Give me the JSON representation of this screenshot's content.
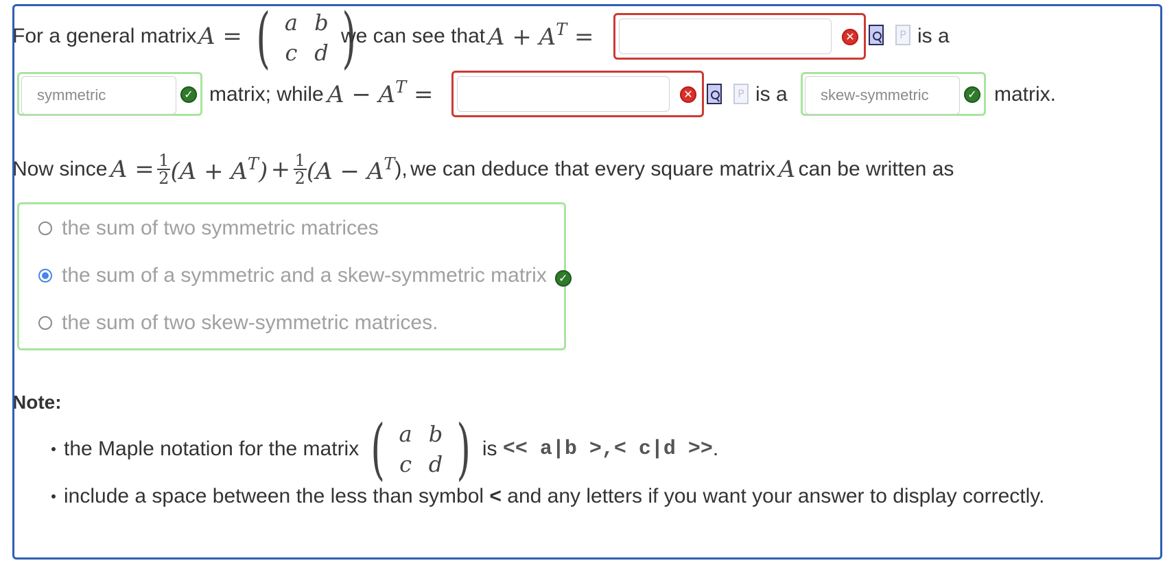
{
  "line1": {
    "prefix": "For a general matrix",
    "math_A_eq": "A =",
    "matrix": [
      "a",
      "b",
      "c",
      "d"
    ],
    "mid": "we can see that",
    "math_sum_base": "A + A",
    "math_sup": "T",
    "math_eq": "=",
    "answer_value": "",
    "suffix": "is a"
  },
  "line2": {
    "type1_value": "symmetric",
    "middle": "matrix; while",
    "math_diff_base": "A − A",
    "math_sup": "T",
    "math_eq": "=",
    "answer_value": "",
    "is_a": "is a",
    "type2_value": "skew-symmetric",
    "suffix": "matrix."
  },
  "line3": {
    "prefix": "Now since",
    "math_start": "A =",
    "half_num": "1",
    "half_den": "2",
    "term1_base": "(A + A",
    "term1_close": ")",
    "plus": "+",
    "term2_base": "(A − A",
    "term2_close": "),",
    "sup": "T",
    "middle": "we can deduce that every square matrix",
    "math_A": "A",
    "suffix": "can be written as"
  },
  "options": [
    {
      "label": "the sum of two symmetric matrices",
      "selected": false
    },
    {
      "label": "the sum of a symmetric and a skew-symmetric matrix",
      "selected": true
    },
    {
      "label": "the sum of two skew-symmetric matrices.",
      "selected": false
    }
  ],
  "note": {
    "title": "Note:",
    "b1_prefix": "the Maple notation for the matrix",
    "b1_is": "is",
    "b1_code": "<< a|b >,< c|d >>",
    "b1_end": ".",
    "b2_text": "include a space between the less than symbol",
    "b2_symbol": "<",
    "b2_rest": "and any letters if you want your answer to display correctly."
  },
  "icons": {
    "error": "error-x-icon",
    "correct": "checkmark-icon",
    "preview": "preview-document-icon",
    "plain": "plain-document-icon",
    "error_glyph": "✕",
    "correct_glyph": "✓",
    "plain_glyph": "P"
  },
  "colors": {
    "error_border": "#cc3b33",
    "correct_border": "#a9e49f",
    "frame_border": "#2f5fb3",
    "radio_selected": "#4a85e8"
  }
}
